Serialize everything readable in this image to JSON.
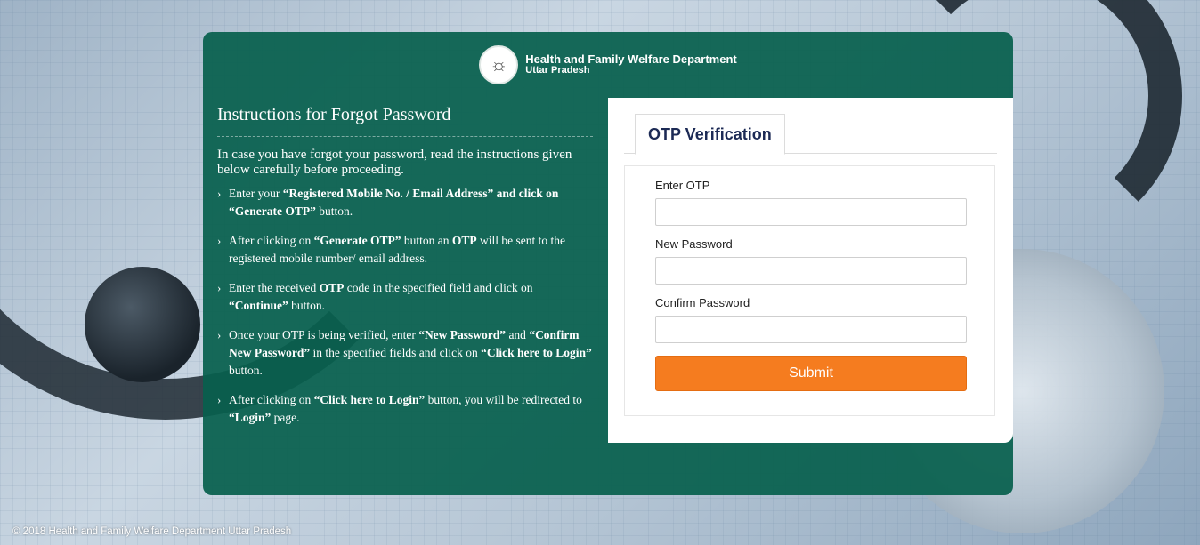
{
  "brand": {
    "emblem_icon": "up-state-emblem-icon",
    "title": "Health and Family Welfare Department",
    "subtitle": "Uttar Pradesh"
  },
  "instructions": {
    "heading": "Instructions for Forgot Password",
    "intro": "In case you have forgot your password, read the instructions given below carefully before proceeding.",
    "steps": [
      {
        "parts": [
          "Enter your ",
          "“Registered Mobile No. / Email Address” and click on “Generate OTP”",
          " button."
        ]
      },
      {
        "parts": [
          "After clicking on ",
          "“Generate OTP”",
          " button an ",
          "OTP",
          " will be sent to the registered mobile number/ email address."
        ]
      },
      {
        "parts": [
          "Enter the received ",
          "OTP",
          " code in the specified field and click on ",
          "“Continue”",
          " button."
        ]
      },
      {
        "parts": [
          "Once your OTP is being verified, enter ",
          "“New Password”",
          " and ",
          "“Confirm New Password”",
          " in the specified fields and click on ",
          "“Click here to Login”",
          " button."
        ]
      },
      {
        "parts": [
          "After clicking on ",
          "“Click here to Login”",
          " button, you will be redirected to ",
          "“Login”",
          " page."
        ]
      }
    ]
  },
  "form": {
    "tab_label": "OTP Verification",
    "otp_label": "Enter OTP",
    "otp_value": "",
    "new_password_label": "New Password",
    "new_password_value": "",
    "confirm_password_label": "Confirm Password",
    "confirm_password_value": "",
    "submit_label": "Submit"
  },
  "footer": {
    "copyright": "© 2018 Health and Family Welfare Department Uttar Pradesh"
  },
  "colors": {
    "card_green": "#08604E",
    "submit_orange": "#F57C1F",
    "tab_text": "#1C2A55"
  }
}
